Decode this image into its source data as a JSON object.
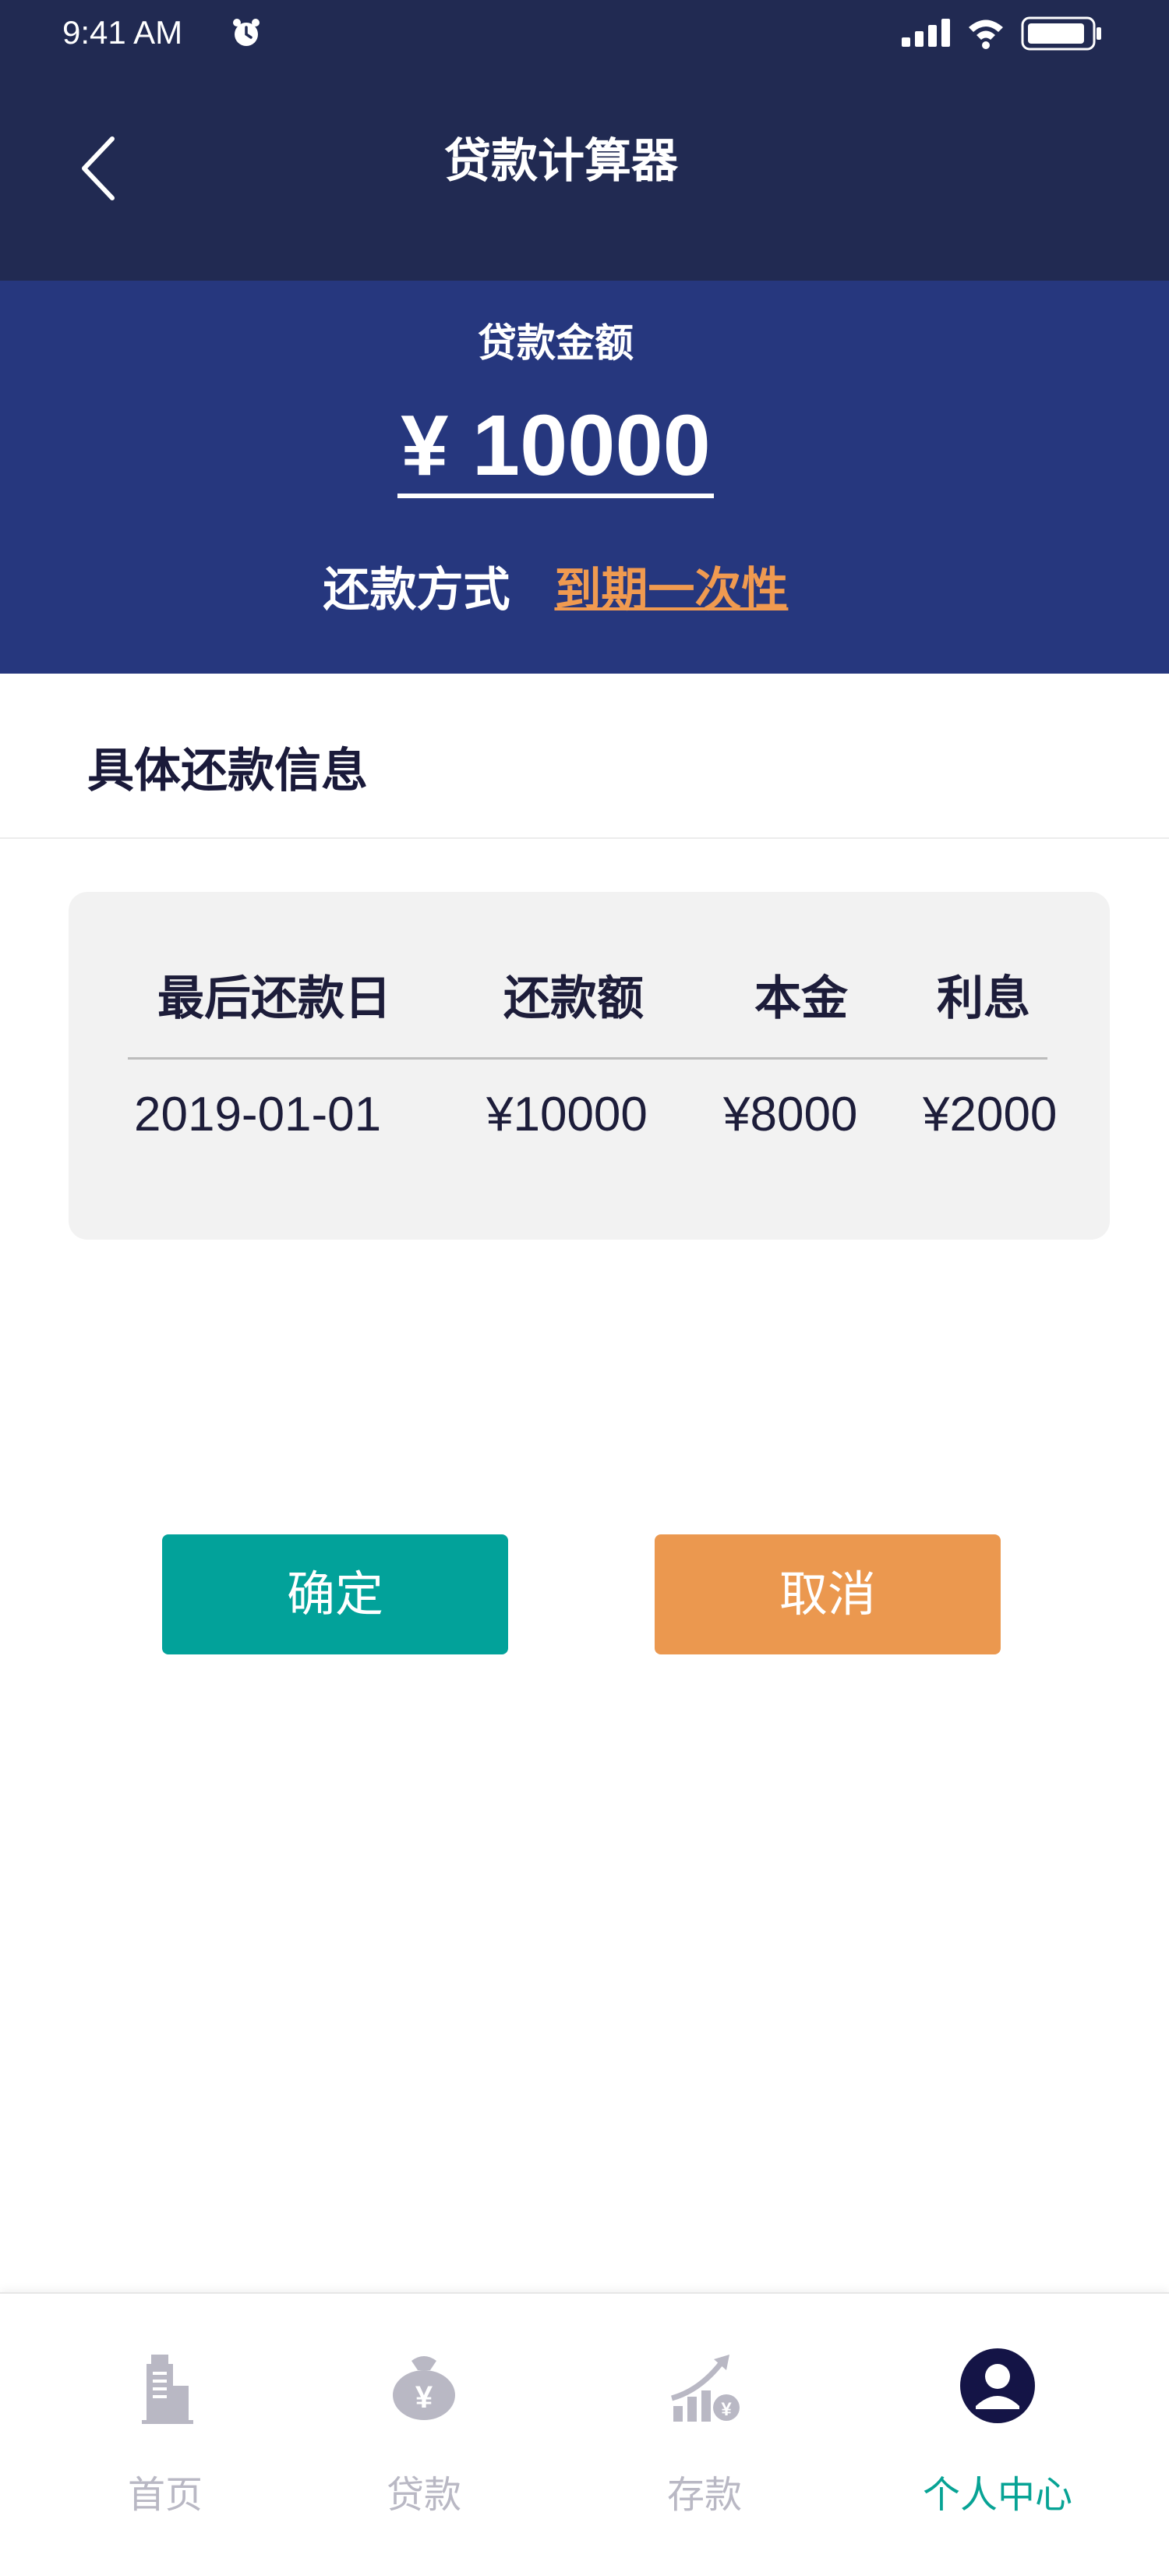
{
  "status_bar": {
    "time": "9:41 AM",
    "icons": [
      "alarm-icon",
      "signal-icon",
      "wifi-icon",
      "battery-icon"
    ]
  },
  "nav": {
    "title": "贷款计算器",
    "back_icon": "chevron-left-icon"
  },
  "amount": {
    "label": "贷款金额",
    "value": "¥ 10000",
    "repay_label": "还款方式",
    "repay_method": "到期一次性"
  },
  "section": {
    "title": "具体还款信息"
  },
  "table": {
    "headers": [
      "最后还款日",
      "还款额",
      "本金",
      "利息"
    ],
    "rows": [
      [
        "2019-01-01",
        "¥10000",
        "¥8000",
        "¥2000"
      ]
    ]
  },
  "buttons": {
    "confirm": "确定",
    "cancel": "取消"
  },
  "tabbar": {
    "items": [
      {
        "label": "首页",
        "icon": "building-icon",
        "active": false
      },
      {
        "label": "贷款",
        "icon": "money-bag-icon",
        "active": false
      },
      {
        "label": "存款",
        "icon": "growth-chart-icon",
        "active": false
      },
      {
        "label": "个人中心",
        "icon": "user-circle-icon",
        "active": true
      }
    ]
  },
  "colors": {
    "header_bg": "#212a52",
    "amount_bg": "#26377e",
    "accent_orange": "#eb984f",
    "accent_teal": "#02a29a",
    "tab_inactive": "#b9b8c4",
    "tab_active": "#07a395"
  }
}
